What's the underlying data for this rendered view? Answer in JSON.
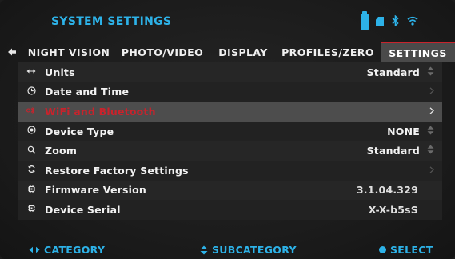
{
  "header": {
    "title": "SYSTEM SETTINGS",
    "icons": [
      "battery-icon",
      "sd-card-icon",
      "bluetooth-icon",
      "wifi-icon"
    ]
  },
  "tabs": [
    {
      "label": "NIGHT VISION",
      "active": false
    },
    {
      "label": "PHOTO/VIDEO",
      "active": false
    },
    {
      "label": "DISPLAY",
      "active": false
    },
    {
      "label": "PROFILES/ZERO",
      "active": false
    },
    {
      "label": "SETTINGS",
      "active": true
    }
  ],
  "rows": [
    {
      "icon": "units-icon",
      "label": "Units",
      "value": "Standard",
      "control": "stepper"
    },
    {
      "icon": "clock-icon",
      "label": "Date and Time",
      "value": "",
      "control": "arrow"
    },
    {
      "icon": "wifi-bluetooth-icon",
      "label": "WiFi and Bluetooth",
      "value": "",
      "control": "arrow",
      "selected": true
    },
    {
      "icon": "device-icon",
      "label": "Device Type",
      "value": "NONE",
      "control": "stepper"
    },
    {
      "icon": "zoom-icon",
      "label": "Zoom",
      "value": "Standard",
      "control": "stepper"
    },
    {
      "icon": "restore-icon",
      "label": "Restore Factory Settings",
      "value": "",
      "control": "arrow"
    },
    {
      "icon": "chip-icon",
      "label": "Firmware Version",
      "value": "3.1.04.329",
      "control": "none"
    },
    {
      "icon": "chip-icon",
      "label": "Device Serial",
      "value": "X-X-b5sS",
      "control": "none"
    }
  ],
  "footer": {
    "category": "CATEGORY",
    "subcategory": "SUBCATEGORY",
    "select": "SELECT"
  },
  "colors": {
    "accent": "#2db2e8",
    "selected_text": "#c8232c",
    "active_tab_border": "#c8232c"
  }
}
